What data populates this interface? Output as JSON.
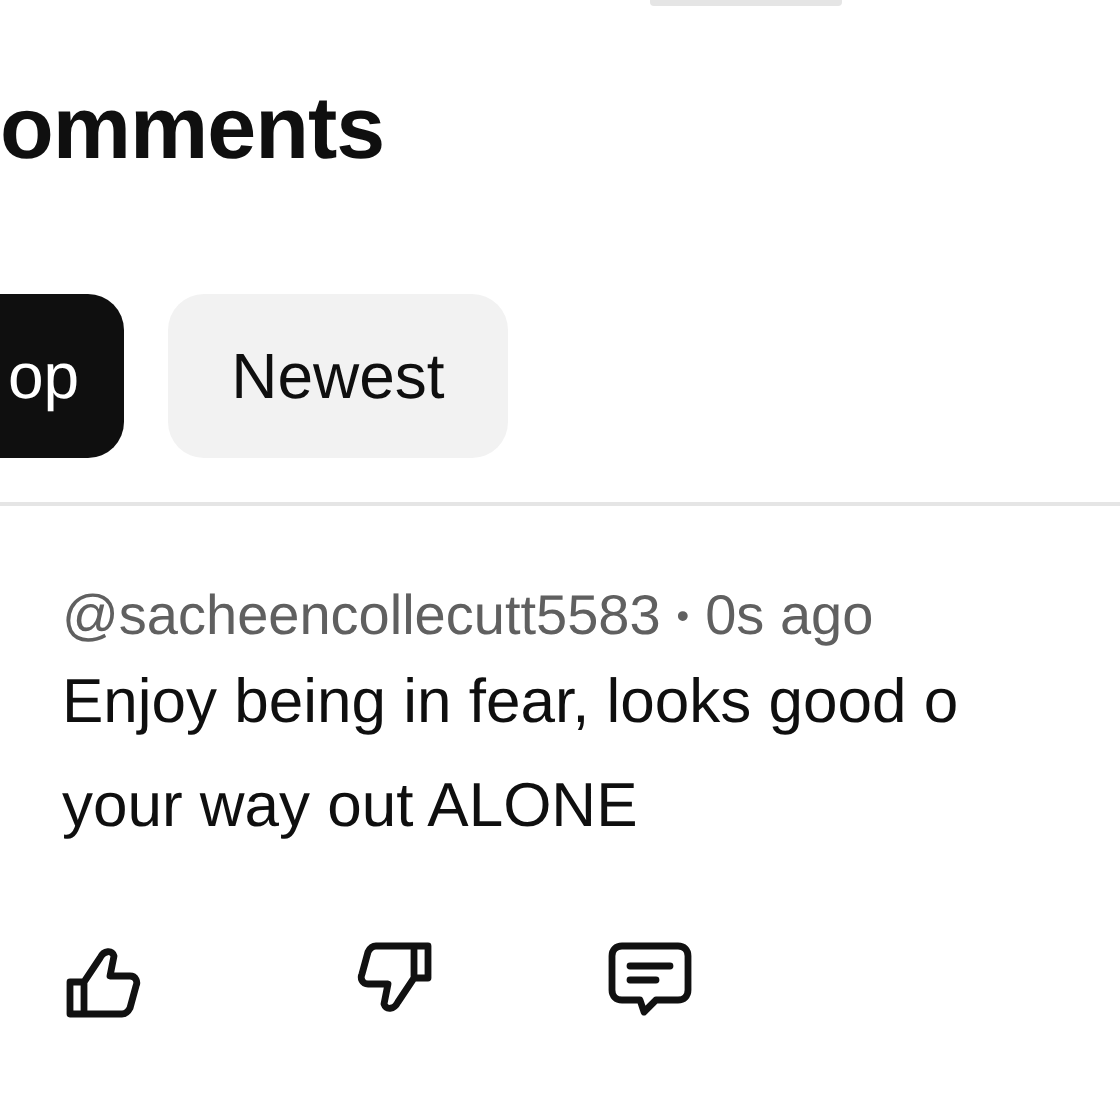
{
  "heading": "omments",
  "chips": [
    {
      "label": "op",
      "selected": true
    },
    {
      "label": "Newest",
      "selected": false
    }
  ],
  "comment": {
    "author": "@sacheencollecutt5583",
    "separator": "•",
    "time": "0s ago",
    "lines": [
      "Enjoy being in fear, looks good o",
      "your way out ALONE"
    ]
  }
}
